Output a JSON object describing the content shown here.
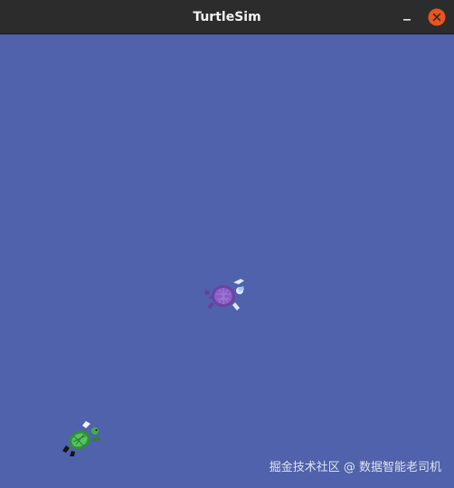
{
  "window": {
    "title": "TurtleSim"
  },
  "titlebar_buttons": {
    "minimize_icon": "minimize-icon",
    "close_icon": "close-icon",
    "close_color": "#e95420"
  },
  "canvas": {
    "background": "#4f62ab"
  },
  "turtles": [
    {
      "icon": "turtle-icon",
      "color": "#7a4fb0"
    },
    {
      "icon": "turtle-icon",
      "color": "#3ea64a"
    }
  ],
  "watermark": "掘金技术社区 @ 数据智能老司机"
}
